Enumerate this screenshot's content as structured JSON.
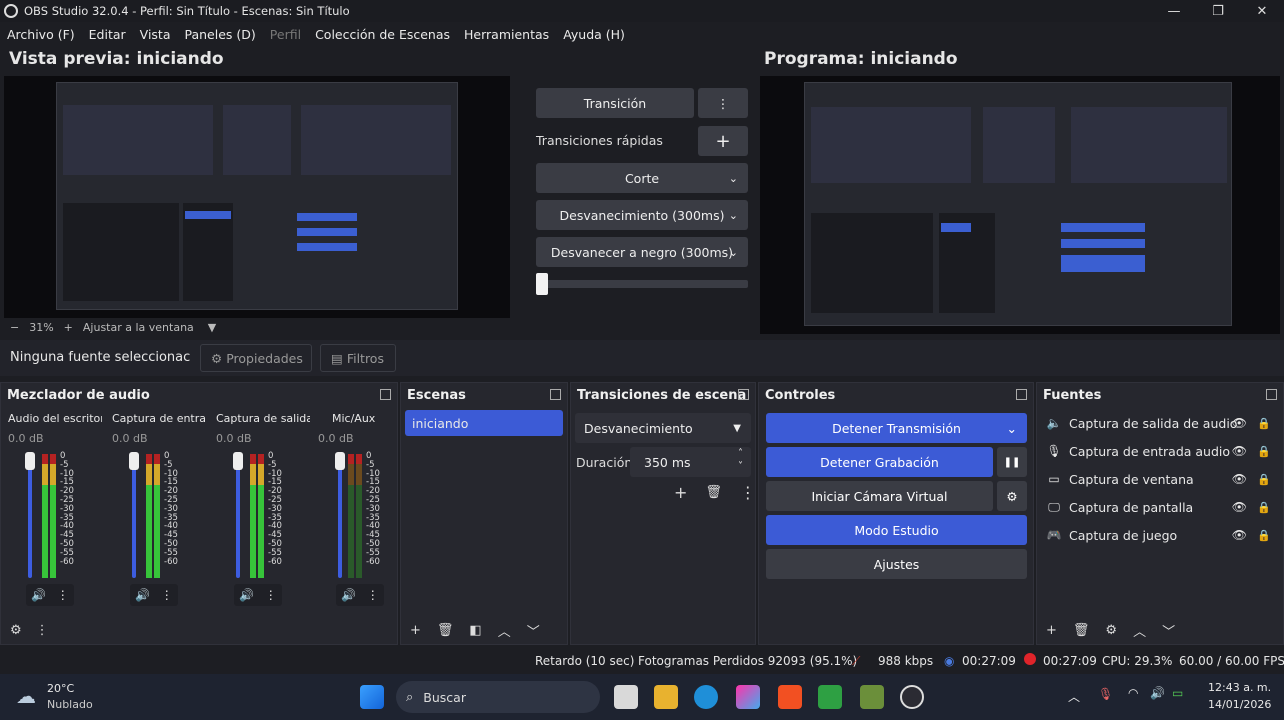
{
  "window": {
    "title": "OBS Studio 32.0.4 - Perfil: Sin Título - Escenas: Sin Título",
    "min": "—",
    "max": "❐",
    "close": "✕"
  },
  "menu": [
    "Archivo (F)",
    "Editar",
    "Vista",
    "Paneles (D)",
    "Perfil",
    "Colección de Escenas",
    "Herramientas",
    "Ayuda (H)"
  ],
  "preview": {
    "title": "Vista previa: iniciando",
    "zoom": "31%",
    "minus": "−",
    "plus": "+",
    "fit": "Ajustar a la ventana",
    "dropdown": "▼"
  },
  "program": {
    "title": "Programa: iniciando"
  },
  "transitions": {
    "transition_btn": "Transición",
    "more": "⋮",
    "quick_label": "Transiciones rápidas",
    "add": "+",
    "cut": "Corte",
    "fade": "Desvanecimiento (300ms)",
    "fade_black": "Desvanecer a negro (300ms)",
    "chev": "⌄"
  },
  "source_bar": {
    "none_selected": "Ninguna fuente seleccionac",
    "properties": "Propiedades",
    "filters": "Filtros",
    "gear": "⚙",
    "filter_icon": "▤"
  },
  "mixer": {
    "title": "Mezclador de audio",
    "channels": [
      {
        "name": "Audio del escritorio",
        "db": "0.0 dB"
      },
      {
        "name": "Captura de entrada",
        "db": "0.0 dB"
      },
      {
        "name": "Captura de salida d",
        "db": "0.0 dB"
      },
      {
        "name": "Mic/Aux",
        "db": "0.0 dB"
      }
    ],
    "scale": [
      "0",
      "-5",
      "-10",
      "-15",
      "-20",
      "-25",
      "-30",
      "-35",
      "-40",
      "-45",
      "-50",
      "-55",
      "-60"
    ],
    "vol_icon": "🔊",
    "more": "⋮",
    "gear": "⚙"
  },
  "scenes": {
    "title": "Escenas",
    "items": [
      "iniciando"
    ],
    "add": "+",
    "del": "🗑",
    "filter": "◧",
    "up": "︿",
    "down": "﹀"
  },
  "scene_transitions": {
    "title": "Transiciones de escena",
    "selected": "Desvanecimiento",
    "duration_label": "Duración",
    "duration": "350 ms",
    "add": "+",
    "del": "🗑",
    "more": "⋮",
    "up": "˄",
    "down": "˅"
  },
  "controls": {
    "title": "Controles",
    "stop_stream": "Detener Transmisión",
    "stop_rec": "Detener Grabación",
    "pause": "❚❚",
    "virtual_cam": "Iniciar Cámara Virtual",
    "studio": "Modo Estudio",
    "settings": "Ajustes",
    "gear": "⚙"
  },
  "sources": {
    "title": "Fuentes",
    "items": [
      {
        "name": "Captura de salida de audio",
        "icon": "🔈"
      },
      {
        "name": "Captura de entrada audio",
        "icon": "🎙"
      },
      {
        "name": "Captura de ventana",
        "icon": "▭"
      },
      {
        "name": "Captura de pantalla",
        "icon": "🖵"
      },
      {
        "name": "Captura de juego",
        "icon": "🎮"
      }
    ],
    "eye": "👁",
    "lock": "🔒",
    "add": "+",
    "del": "🗑",
    "gear": "⚙",
    "up": "︿",
    "down": "﹀"
  },
  "status": {
    "delay": "Retardo (10 sec)",
    "dropped": "Fotogramas Perdidos 92093 (95.1%)",
    "kbps": "988 kbps",
    "stream_time": "00:27:09",
    "rec_time": "00:27:09",
    "cpu": "CPU: 29.3%",
    "fps": "60.00 / 60.00 FPS"
  },
  "taskbar": {
    "temp": "20°C",
    "weather": "Nublado",
    "search": "Buscar",
    "time": "12:43 a. m.",
    "date": "14/01/2026"
  }
}
